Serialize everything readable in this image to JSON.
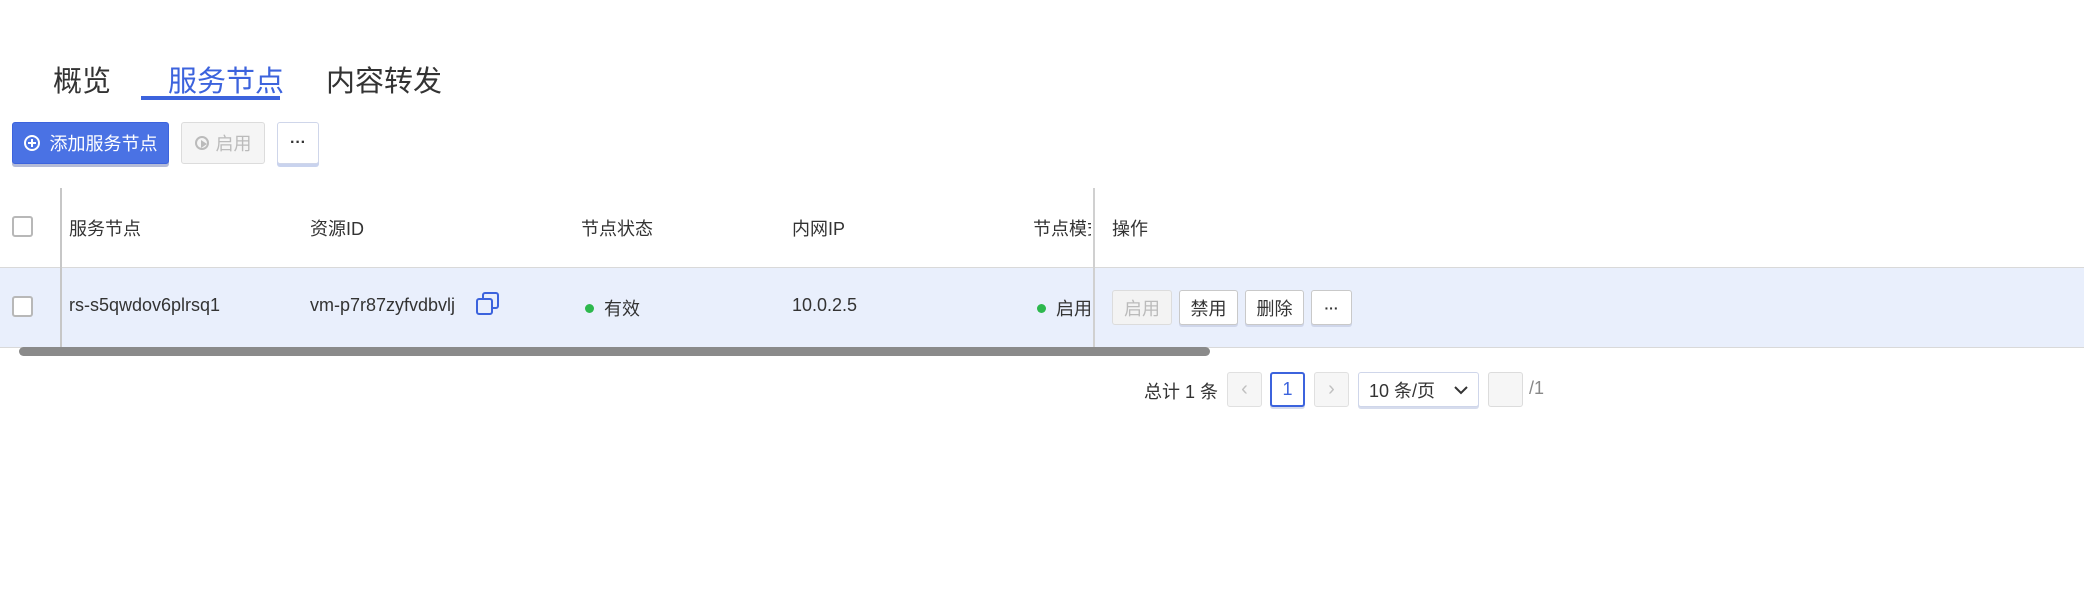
{
  "tabs": [
    {
      "label": "概览",
      "active": false
    },
    {
      "label": "服务节点",
      "active": true
    },
    {
      "label": "内容转发",
      "active": false
    }
  ],
  "toolbar": {
    "add_label": "添加服务节点",
    "enable_label": "启用",
    "more_label": "···"
  },
  "table": {
    "headers": {
      "name": "服务节点",
      "resource_id": "资源ID",
      "status": "节点状态",
      "private_ip": "内网IP",
      "mode": "节点模式",
      "actions": "操作"
    },
    "rows": [
      {
        "name": "rs-s5qwdov6plrsq1",
        "resource_id": "vm-p7r87zyfvdbvlj",
        "status": "有效",
        "private_ip": "10.0.2.5",
        "mode": "启用",
        "actions": {
          "enable": "启用",
          "disable": "禁用",
          "delete": "删除",
          "more": "···"
        }
      }
    ]
  },
  "pagination": {
    "total": "总计 1 条",
    "prev": "‹",
    "current_page": "1",
    "next": "›",
    "page_size": "10 条/页",
    "jump_value": "",
    "total_pages": "/1"
  },
  "colors": {
    "accent": "#3c63dd",
    "primary_button": "#4a72e4",
    "row_selected": "#e9effc",
    "status_green": "#2db84d"
  }
}
